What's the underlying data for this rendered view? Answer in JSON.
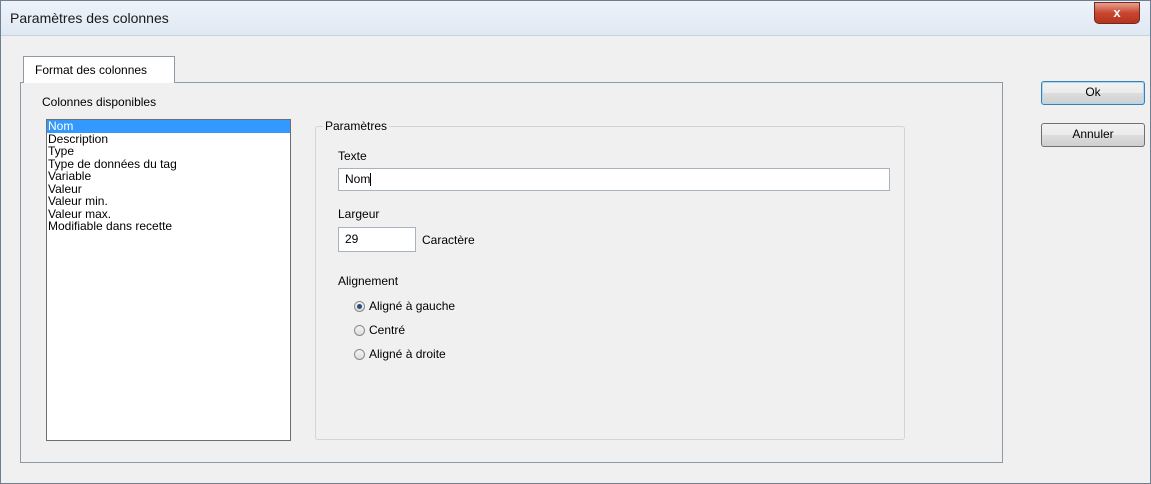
{
  "window": {
    "title": "Paramètres des colonnes",
    "close_glyph": "x"
  },
  "tab": {
    "label": "Format des colonnes"
  },
  "available": {
    "label": "Colonnes disponibles",
    "items": [
      "Nom",
      "Description",
      "Type",
      "Type de données du tag",
      "Variable",
      "Valeur",
      "Valeur min.",
      "Valeur max.",
      "Modifiable dans recette"
    ],
    "selected_index": 0
  },
  "parameters": {
    "legend": "Paramètres",
    "text_label": "Texte",
    "text_value": "Nom",
    "width_label": "Largeur",
    "width_value": "29",
    "width_unit": "Caractère",
    "alignment_label": "Alignement",
    "alignment_options": [
      "Aligné à gauche",
      "Centré",
      "Aligné à droite"
    ],
    "alignment_selected": 0
  },
  "buttons": {
    "ok": "Ok",
    "cancel": "Annuler"
  },
  "colors": {
    "selection": "#3399ff",
    "close_button": "#c7462f"
  }
}
